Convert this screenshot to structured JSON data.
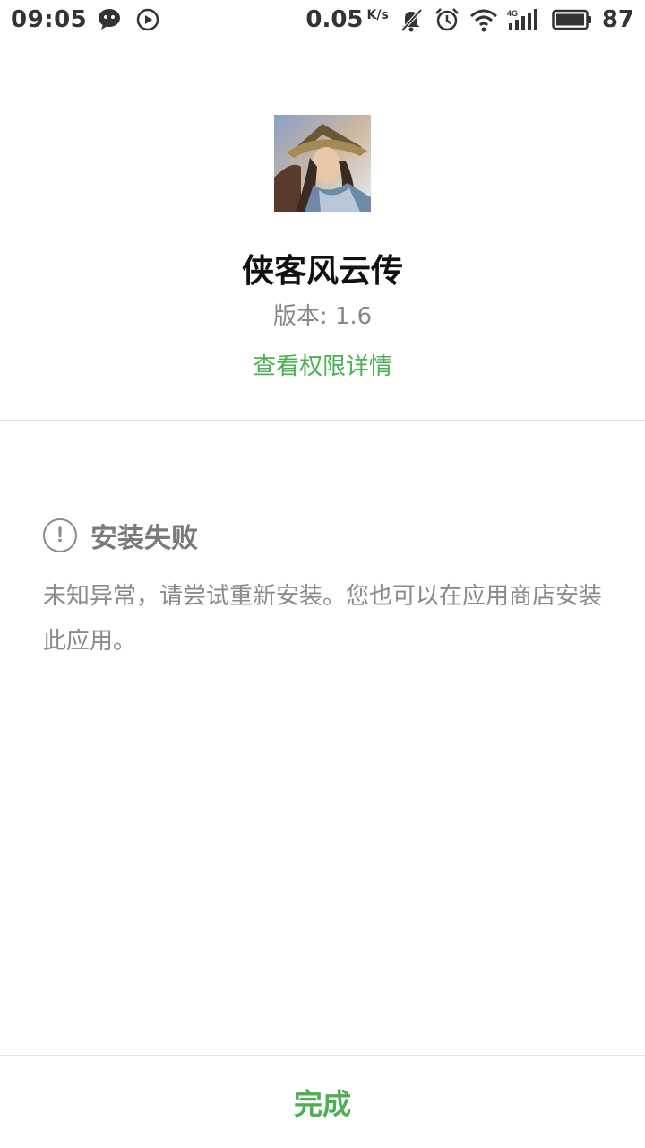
{
  "status_bar": {
    "time": "09:05",
    "net_speed": "0.05",
    "net_unit": "K/s",
    "signal_label": "4G",
    "battery": "87",
    "icons": [
      "wechat-icon",
      "play-icon",
      "mute-bell-icon",
      "alarm-icon",
      "wifi-icon",
      "signal-icon",
      "battery-icon"
    ]
  },
  "app": {
    "name": "侠客风云传",
    "version": "版本: 1.6",
    "permission_link": "查看权限详情"
  },
  "install": {
    "status_title": "安装失败",
    "message": "未知异常，请尝试重新安装。您也可以在应用商店安装此应用。",
    "icon": "exclamation-circle-icon"
  },
  "footer": {
    "done_label": "完成"
  },
  "colors": {
    "accent": "#4caf50",
    "muted_text": "#8a8a8a"
  }
}
